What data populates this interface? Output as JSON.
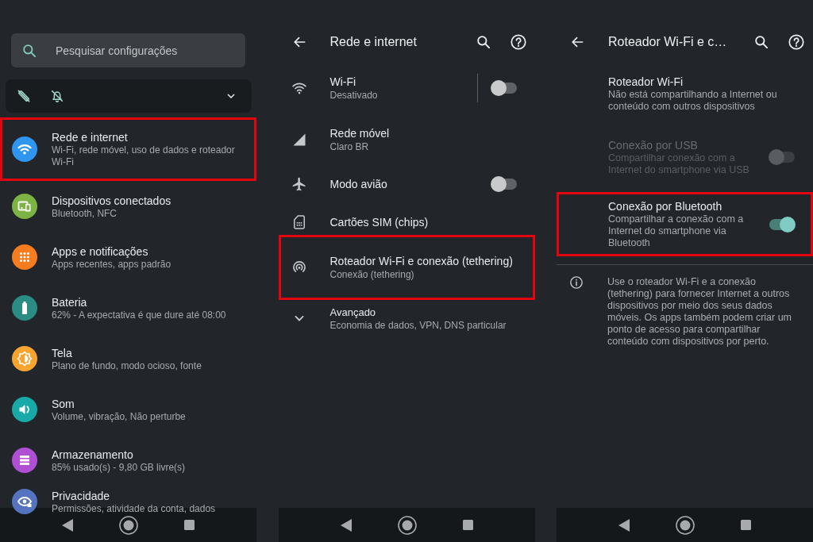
{
  "screens": [
    {
      "kind": "main",
      "search": {
        "placeholder": "Pesquisar configurações"
      },
      "condition_bar": {
        "expanded": false
      },
      "items": [
        {
          "title": "Rede e internet",
          "subtitle": "Wi-Fi, rede móvel, uso de dados e roteador Wi-Fi",
          "color": "#2f96f0",
          "highlighted": true
        },
        {
          "title": "Dispositivos conectados",
          "subtitle": "Bluetooth, NFC",
          "color": "#7cb342",
          "highlighted": false
        },
        {
          "title": "Apps e notificações",
          "subtitle": "Apps recentes, apps padrão",
          "color": "#f57c1f",
          "highlighted": false
        },
        {
          "title": "Bateria",
          "subtitle": "62% - A expectativa é que dure até 08:00",
          "color": "#2a8c82",
          "highlighted": false
        },
        {
          "title": "Tela",
          "subtitle": "Plano de fundo, modo ocioso, fonte",
          "color": "#f7a530",
          "highlighted": false
        },
        {
          "title": "Som",
          "subtitle": "Volume, vibração, Não perturbe",
          "color": "#17aaa6",
          "highlighted": false
        },
        {
          "title": "Armazenamento",
          "subtitle": "85% usado(s) - 9,80 GB livre(s)",
          "color": "#b04fd4",
          "highlighted": false
        },
        {
          "title": "Privacidade",
          "subtitle": "Permissões, atividade da conta, dados",
          "color": "#5574c0",
          "highlighted": false
        }
      ]
    },
    {
      "kind": "subpage",
      "title": "Rede e internet",
      "items": [
        {
          "kind": "split_switch",
          "title": "Wi-Fi",
          "subtitle": "Desativado",
          "on": false,
          "highlighted": false
        },
        {
          "kind": "link",
          "title": "Rede móvel",
          "subtitle": "Claro BR",
          "highlighted": false
        },
        {
          "kind": "switch",
          "title": "Modo avião",
          "on": false,
          "highlighted": false
        },
        {
          "kind": "link",
          "title": "Cartões SIM (chips)",
          "highlighted": false
        },
        {
          "kind": "link",
          "title": "Roteador Wi-Fi e conexão (tethering)",
          "subtitle": "Conexão (tethering)",
          "highlighted": true
        },
        {
          "kind": "expand",
          "title": "Avançado",
          "subtitle": "Economia de dados, VPN, DNS particular",
          "highlighted": false
        }
      ]
    },
    {
      "kind": "subpage",
      "title": "Roteador Wi-Fi e c…",
      "items": [
        {
          "kind": "link",
          "title": "Roteador Wi-Fi",
          "subtitle": "Não está compartilhando a Internet ou conteúdo com outros dispositivos",
          "disabled": false,
          "highlighted": false
        },
        {
          "kind": "switch",
          "title": "Conexão por USB",
          "subtitle": "Compartilhar conexão com a Internet do smartphone via USB",
          "on": false,
          "disabled": true,
          "highlighted": false
        },
        {
          "kind": "switch",
          "title": "Conexão por Bluetooth",
          "subtitle": "Compartilhar a conexão com a Internet do smartphone via Bluetooth",
          "on": true,
          "disabled": false,
          "highlighted": true
        }
      ],
      "info": "Use o roteador Wi-Fi e a conexão (tethering) para fornecer Internet a outros dispositivos por meio dos seus dados móveis. Os apps também podem criar um ponto de acesso para compartilhar conteúdo com dispositivos por perto."
    }
  ]
}
